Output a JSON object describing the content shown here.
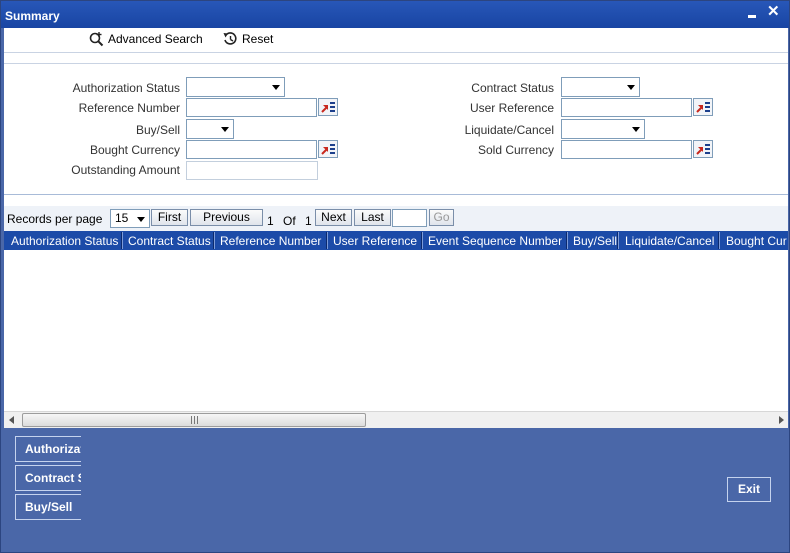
{
  "window": {
    "title": "Summary",
    "close_label": "✕"
  },
  "toolbar": {
    "advanced_search_label": "Advanced Search",
    "reset_label": "Reset"
  },
  "form": {
    "authorization_status_label": "Authorization Status",
    "reference_number_label": "Reference Number",
    "buy_sell_label": "Buy/Sell",
    "bought_currency_label": "Bought Currency",
    "outstanding_amount_label": "Outstanding Amount",
    "contract_status_label": "Contract Status",
    "user_reference_label": "User Reference",
    "liquidate_cancel_label": "Liquidate/Cancel",
    "sold_currency_label": "Sold Currency"
  },
  "pager": {
    "records_per_page_label": "Records per page",
    "records_per_page_value": "15",
    "first_label": "First",
    "previous_label": "Previous",
    "current_page": "1",
    "of_label": "Of",
    "total_pages": "1",
    "next_label": "Next",
    "last_label": "Last",
    "go_label": "Go"
  },
  "grid": {
    "columns": [
      "Authorization Status",
      "Contract Status",
      "Reference Number",
      "User Reference",
      "Event Sequence Number",
      "Buy/Sell",
      "Liquidate/Cancel",
      "Bought Cur"
    ]
  },
  "footer": {
    "buttons": [
      "Authorizat",
      "Contract S",
      "Buy/Sell"
    ],
    "exit_label": "Exit"
  },
  "icons": {
    "advanced_search": "search-plus-icon",
    "reset": "reset-icon",
    "lov": "list-of-values-icon"
  },
  "colors": {
    "title_bar": "#1845a3",
    "grid_header": "#1c4ba8",
    "panel": "#4a67a8"
  }
}
